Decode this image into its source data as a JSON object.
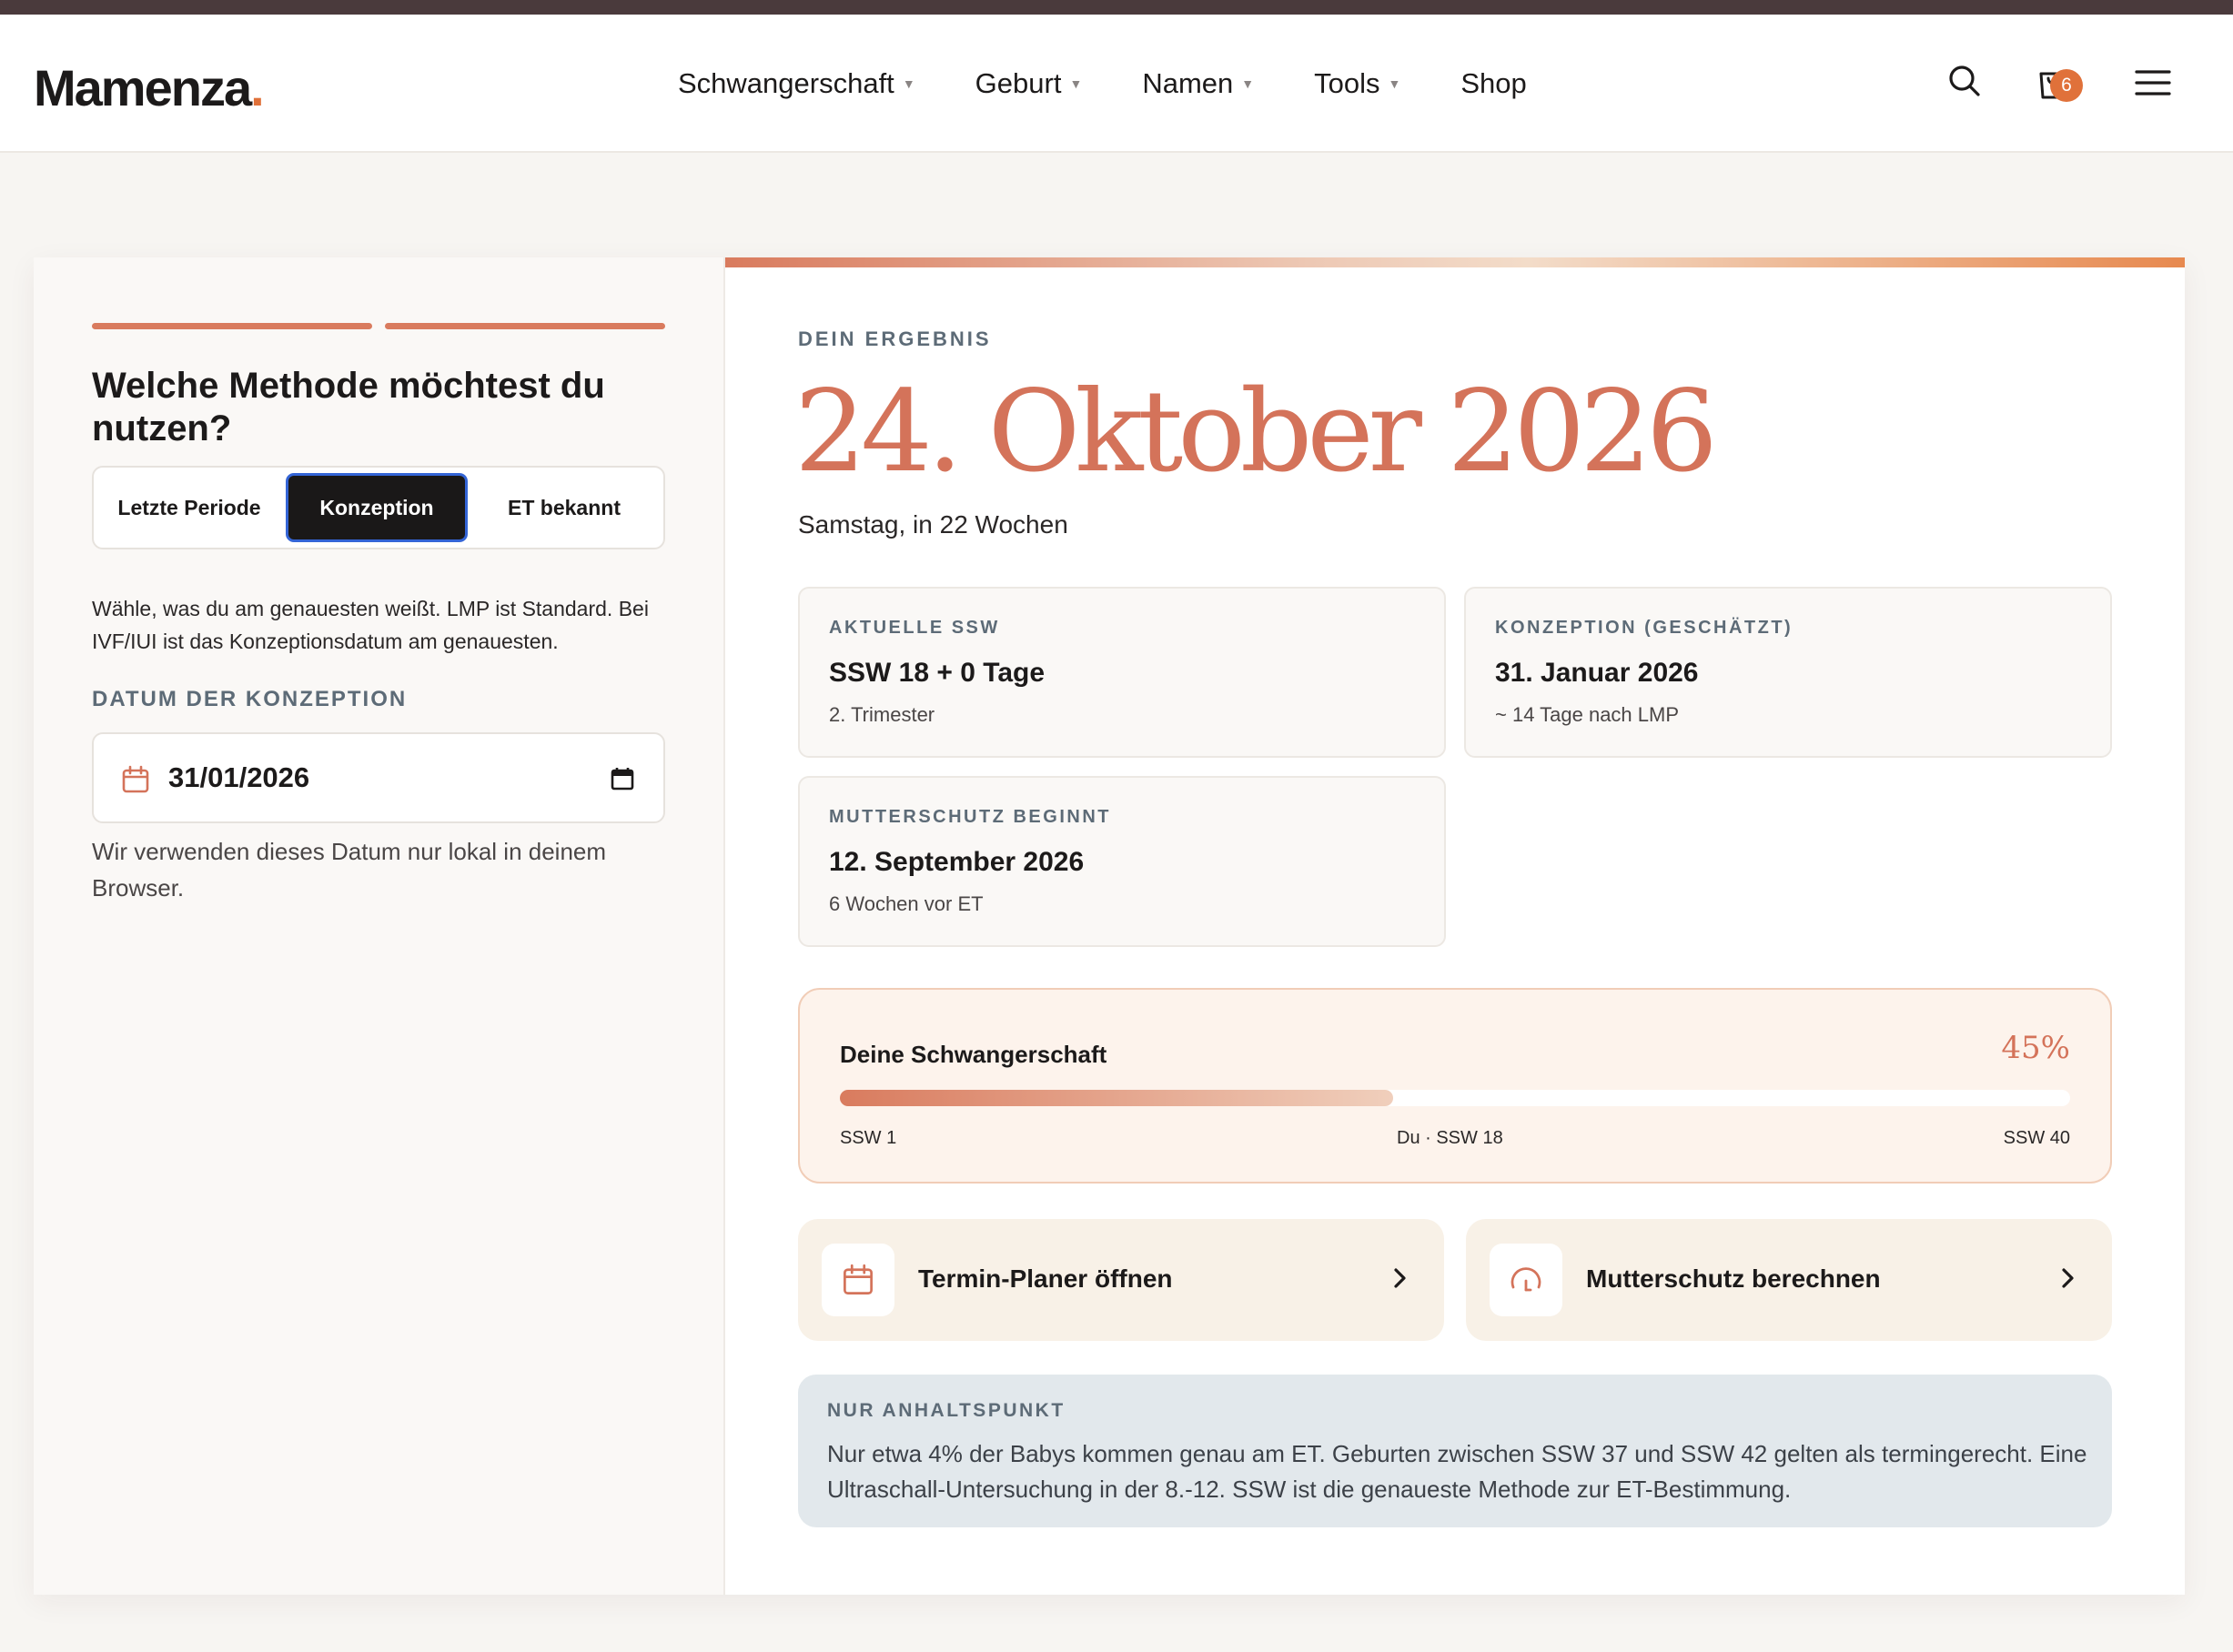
{
  "header": {
    "logo": "Mamenza",
    "logo_dot": ".",
    "nav": [
      {
        "label": "Schwangerschaft",
        "has_dropdown": true
      },
      {
        "label": "Geburt",
        "has_dropdown": true
      },
      {
        "label": "Namen",
        "has_dropdown": true
      },
      {
        "label": "Tools",
        "has_dropdown": true
      },
      {
        "label": "Shop",
        "has_dropdown": false
      }
    ],
    "cart_count": "6",
    "icons": [
      "search-icon",
      "shopping-bag-icon",
      "menu-icon"
    ]
  },
  "form": {
    "title": "Welche Methode möchtest du nutzen?",
    "methods": [
      "Letzte Periode",
      "Konzeption",
      "ET bekannt"
    ],
    "selected_method": "Konzeption",
    "help_text": "Wähle, was du am genauesten weißt. LMP ist Standard. Bei IVF/IUI ist das Konzeptionsdatum am genauesten.",
    "date_label": "DATUM DER KONZEPTION",
    "date_value": "31/01/2026",
    "date_note": "Wir verwenden dieses Datum nur lokal in deinem Browser."
  },
  "result": {
    "label": "DEIN ERGEBNIS",
    "due_date": "24. Oktober 2026",
    "due_sub": "Samstag, in 22 Wochen",
    "cards": [
      {
        "label": "AKTUELLE SSW",
        "value": "SSW 18 + 0 Tage",
        "sub": "2. Trimester"
      },
      {
        "label": "KONZEPTION (GESCHÄTZT)",
        "value": "31. Januar 2026",
        "sub": "~ 14 Tage nach LMP"
      },
      {
        "label": "MUTTERSCHUTZ BEGINNT",
        "value": "12. September 2026",
        "sub": "6 Wochen vor ET"
      }
    ]
  },
  "progress": {
    "title": "Deine Schwangerschaft",
    "percent_label": "45%",
    "fraction": 0.45,
    "start_label": "SSW 1",
    "current_label": "Du · SSW 18",
    "end_label": "SSW 40"
  },
  "actions": [
    {
      "label": "Termin-Planer öffnen",
      "icon": "calendar-icon"
    },
    {
      "label": "Mutterschutz berechnen",
      "icon": "gauge-icon"
    }
  ],
  "note": {
    "label": "NUR ANHALTSPUNKT",
    "text": "Nur etwa 4% der Babys kommen genau am ET. Geburten zwischen SSW 37 und SSW 42 gelten als termingerecht. Eine Ultraschall-Untersuchung in der 8.-12. SSW ist die genaueste Methode zur ET-Bestimmung."
  },
  "colors": {
    "accent": "#d4735a",
    "brand_orange": "#e0713a",
    "dark": "#1a1818",
    "selected_outline": "#3465d6",
    "muted_label": "#5d6b77"
  }
}
